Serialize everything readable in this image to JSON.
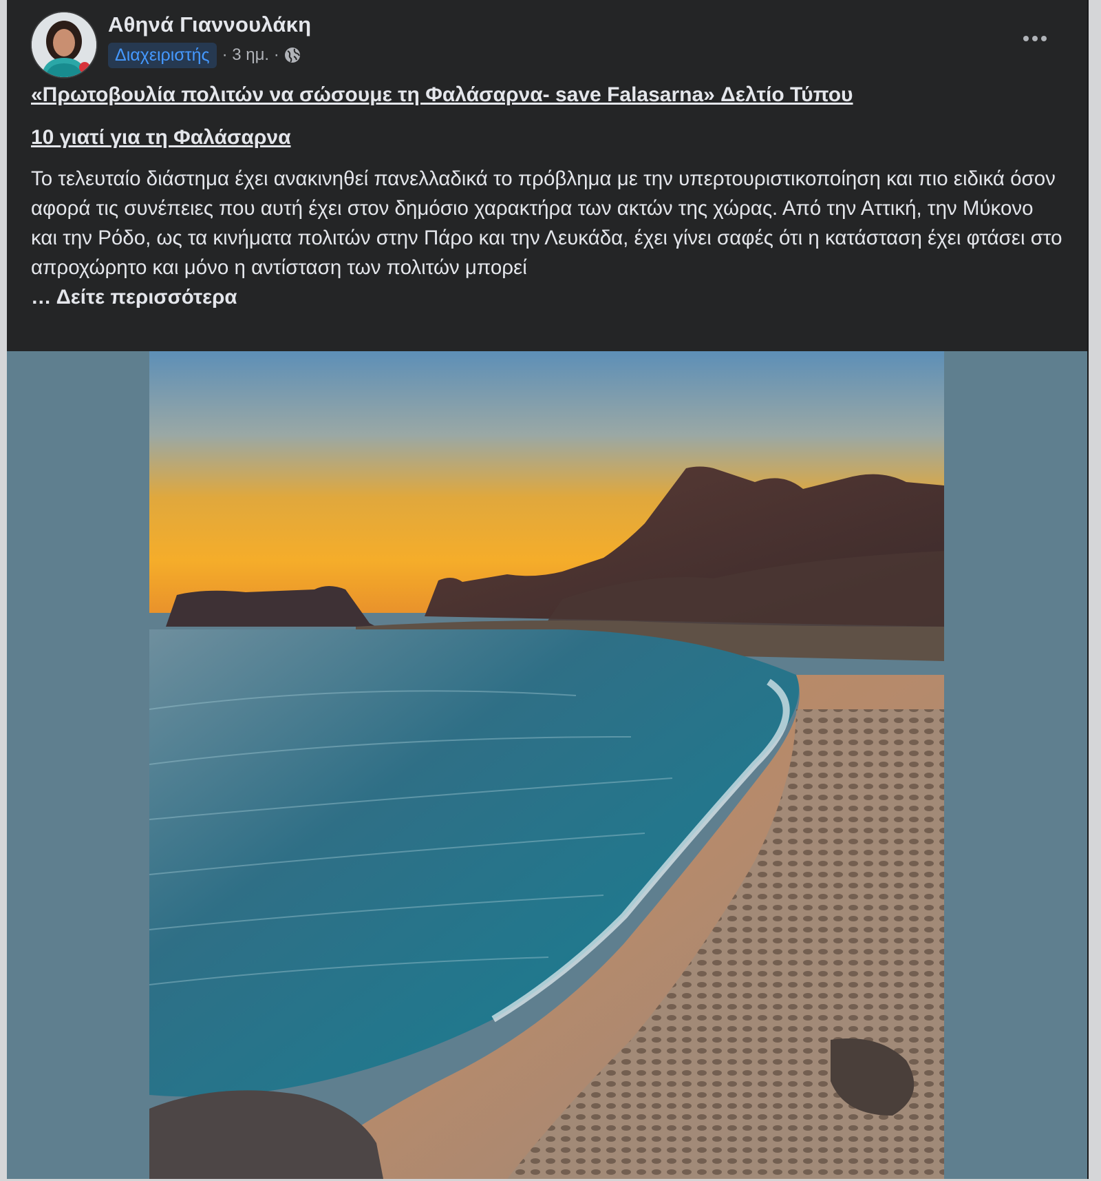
{
  "post": {
    "author_name": "Αθηνά Γιαννουλάκη",
    "role_badge": "Διαχειριστής",
    "timestamp": "· 3 ημ. ·",
    "audience_icon": "globe-icon",
    "more_icon": "more-options-icon",
    "link_title": "«Πρωτοβουλία πολιτών να σώσουμε τη Φαλάσαρνα- save Falasarna» Δελτίο Τύπου",
    "link_subtitle": "10 γιατί για τη Φαλάσαρνα",
    "body_text": "Το τελευταίο διάστημα έχει ανακινηθεί πανελλαδικά το πρόβλημα με την υπερτουριστικοποίηση και πιο ειδικά όσον αφορά τις συνέπειες που αυτή έχει στον δημόσιο χαρακτήρα των ακτών της χώρας. Από την Αττική, την Μύκονο και την Ρόδο, ως τα κινήματα πολιτών στην Πάρο και την Λευκάδα, έχει γίνει σαφές ότι η κατάσταση έχει φτάσει στο απροχώρητο και μόνο η αντίσταση των πολιτών μπορεί",
    "see_more_label": "… Δείτε περισσότερα"
  },
  "colors": {
    "post_background": "#242526",
    "text_primary": "#e4e6eb",
    "text_secondary": "#b0b3b8",
    "badge_background": "#263951",
    "badge_text": "#4599ff",
    "media_background": "#5f7f8f"
  }
}
